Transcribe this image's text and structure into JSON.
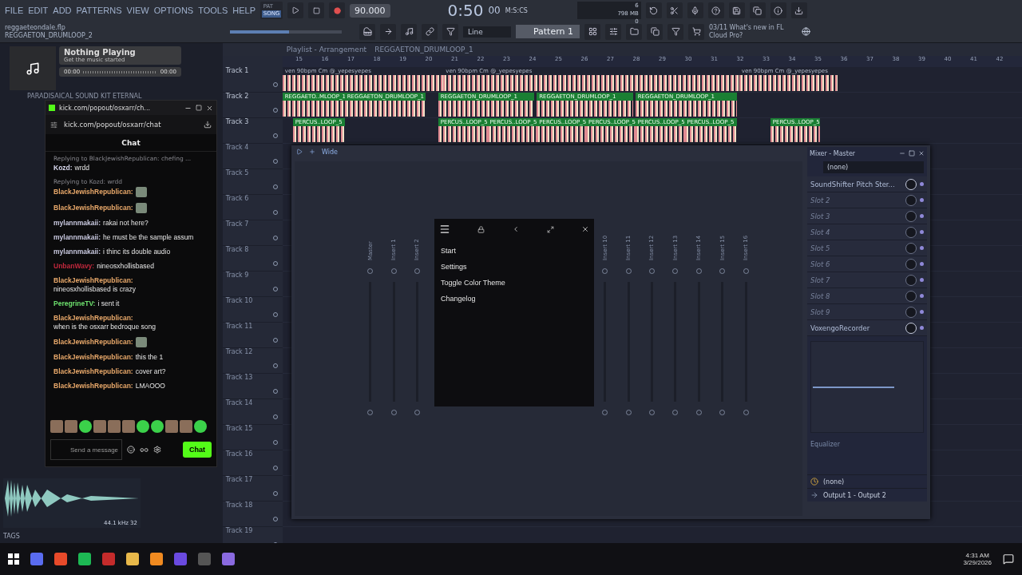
{
  "menu": [
    "FILE",
    "EDIT",
    "ADD",
    "PATTERNS",
    "VIEW",
    "OPTIONS",
    "TOOLS",
    "HELP"
  ],
  "transport": {
    "pat": "PAT",
    "song": "SONG",
    "song_selected": true,
    "tempo": "90.000",
    "time": "0:50",
    "time_small": "00",
    "time_label": "M:S:CS"
  },
  "project": {
    "file": "reggaeteondale.flp",
    "pattern": "REGGAETON_DRUMLOOP_2"
  },
  "monitor": {
    "cpu": "6",
    "memory": "798 MB",
    "voices": "0"
  },
  "master_volume": {
    "level": 0.53
  },
  "snap": "Line",
  "pattern_selector": "Pattern 1",
  "news": {
    "date": "03/11",
    "text": "What's new in FL Cloud Pro?"
  },
  "media_player": {
    "title": "Nothing Playing",
    "subtitle": "Get the music started",
    "elapsed": "00:00",
    "total": "00:00"
  },
  "browser": {
    "tree_item": "PARADISAICAL SOUND KIT ETERNAL",
    "sample_info": "44.1 kHz 32",
    "tags": "TAGS"
  },
  "playlist": {
    "title": "Playlist - Arrangement",
    "pattern": "REGGAETON_DRUMLOOP_1",
    "bars": [
      "15",
      "16",
      "17",
      "18",
      "19",
      "20",
      "21",
      "22",
      "23",
      "24",
      "25",
      "26",
      "27",
      "28",
      "29",
      "30",
      "31",
      "32",
      "33",
      "34",
      "35",
      "36",
      "37",
      "38",
      "39",
      "40",
      "41",
      "42"
    ],
    "tracks": [
      {
        "name": "Track 1",
        "clips": [
          {
            "kind": "audio",
            "label": "ven 90bpm Cm @_yepesyepes"
          },
          {
            "kind": "audio",
            "label": "ven 90bpm Cm @_yepesyepes"
          },
          {
            "kind": "audio",
            "label": "ven 90bpm Cm @_yepesyepes"
          }
        ]
      },
      {
        "name": "Track 2",
        "clips": [
          {
            "kind": "pattern",
            "label": "REGGAETO..MLOOP_1"
          },
          {
            "kind": "pattern",
            "label": "REGGAETON_DRUMLOOP_1"
          },
          {
            "kind": "pattern",
            "label": "REGGAETON_DRUMLOOP_1"
          },
          {
            "kind": "pattern",
            "label": "REGGAETON_DRUMLOOP_1"
          },
          {
            "kind": "pattern",
            "label": "REGGAETON_DRUMLOOP_1"
          }
        ]
      },
      {
        "name": "Track 3",
        "clips": [
          {
            "kind": "pattern",
            "label": "PERCUS..LOOP_5"
          },
          {
            "kind": "pattern",
            "label": "PERCUS..LOOP_5"
          },
          {
            "kind": "pattern",
            "label": "PERCUS..LOOP_5"
          },
          {
            "kind": "pattern",
            "label": "PERCUS..LOOP_5"
          },
          {
            "kind": "pattern",
            "label": "PERCUS..LOOP_5"
          },
          {
            "kind": "pattern",
            "label": "PERCUS..LOOP_5"
          },
          {
            "kind": "pattern",
            "label": "PERCUS..LOOP_5"
          },
          {
            "kind": "pattern",
            "label": "PERCUS..LOOP_5"
          }
        ]
      },
      {
        "name": "Track 4"
      },
      {
        "name": "Track 5"
      },
      {
        "name": "Track 6"
      },
      {
        "name": "Track 7"
      },
      {
        "name": "Track 8"
      },
      {
        "name": "Track 9"
      },
      {
        "name": "Track 10"
      },
      {
        "name": "Track 11"
      },
      {
        "name": "Track 12"
      },
      {
        "name": "Track 13"
      },
      {
        "name": "Track 14"
      },
      {
        "name": "Track 15"
      },
      {
        "name": "Track 16"
      },
      {
        "name": "Track 17"
      },
      {
        "name": "Track 18"
      },
      {
        "name": "Track 19"
      }
    ]
  },
  "mixer": {
    "stereo": "Wide",
    "strips_left": [
      "Master",
      "Insert 1",
      "Insert 2"
    ],
    "strips_right": [
      "Insert 10",
      "Insert 11",
      "Insert 12",
      "Insert 13",
      "Insert 14",
      "Insert 15",
      "Insert 16"
    ],
    "menu": [
      "Start",
      "Settings",
      "Toggle Color Theme",
      "Changelog"
    ],
    "panel": {
      "title": "Mixer - Master",
      "input": "(none)",
      "slots": [
        {
          "label": "SoundShifter Pitch Ster...",
          "empty": false
        },
        {
          "label": "Slot 2",
          "empty": true
        },
        {
          "label": "Slot 3",
          "empty": true
        },
        {
          "label": "Slot 4",
          "empty": true
        },
        {
          "label": "Slot 5",
          "empty": true
        },
        {
          "label": "Slot 6",
          "empty": true
        },
        {
          "label": "Slot 7",
          "empty": true
        },
        {
          "label": "Slot 8",
          "empty": true
        },
        {
          "label": "Slot 9",
          "empty": true
        },
        {
          "label": "VoxengoRecorder",
          "empty": false
        }
      ],
      "eq": "Equalizer",
      "sidechain": "(none)",
      "output": "Output 1 - Output 2"
    }
  },
  "chat": {
    "tab": "kick.com/popout/osxarr/ch...",
    "url": "kick.com/popout/osxarr/chat",
    "title": "Chat",
    "placeholder": "Send a message",
    "send": "Chat",
    "messages": [
      {
        "reply": "Replying to BlackJewishRepublican: chefing ...",
        "user": "Kozd:",
        "color": "#d8d8ee",
        "kind": "text",
        "text": "wrdd"
      },
      {
        "reply": "Replying to Kozd: wrdd",
        "user": "BlackJewishRepublican:",
        "color": "#e8a86a",
        "kind": "emote"
      },
      {
        "user": "BlackJewishRepublican:",
        "color": "#e8a86a",
        "kind": "emote"
      },
      {
        "user": "mylannmakaii:",
        "color": "#c9c9e0",
        "kind": "text",
        "text": "rakai not here?"
      },
      {
        "user": "mylannmakaii:",
        "color": "#c9c9e0",
        "kind": "text",
        "text": "he must be the sample assum"
      },
      {
        "user": "mylannmakaii:",
        "color": "#c9c9e0",
        "kind": "text",
        "text": "i thinc its double audio"
      },
      {
        "user": "UnbanWavy:",
        "color": "#c0283c",
        "kind": "text",
        "text": "nineosxhollisbased"
      },
      {
        "user": "BlackJewishRepublican:",
        "color": "#e8a86a",
        "kind": "text",
        "text": "nineosxhollisbased is crazy"
      },
      {
        "user": "PeregrineTV:",
        "color": "#6de06d",
        "kind": "text",
        "text": "i sent it"
      },
      {
        "user": "BlackJewishRepublican:",
        "color": "#e8a86a",
        "kind": "text",
        "text": "when is the osxarr bedroque song"
      },
      {
        "user": "BlackJewishRepublican:",
        "color": "#e8a86a",
        "kind": "emote"
      },
      {
        "user": "BlackJewishRepublican:",
        "color": "#e8a86a",
        "kind": "text",
        "text": "this the 1"
      },
      {
        "user": "BlackJewishRepublican:",
        "color": "#e8a86a",
        "kind": "text",
        "text": "cover art?"
      },
      {
        "user": "BlackJewishRepublican:",
        "color": "#e8a86a",
        "kind": "text",
        "text": "LMAOOO"
      }
    ]
  },
  "taskbar": {
    "time": "4:31 AM",
    "date": "3/29/2026"
  }
}
